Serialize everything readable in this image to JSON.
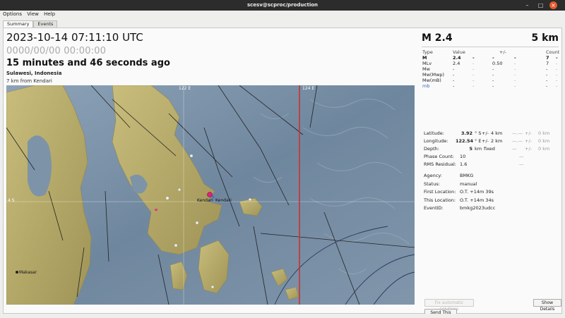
{
  "window": {
    "title": "scesv@scproc/production"
  },
  "menu": [
    "Options",
    "View",
    "Help"
  ],
  "tabs": [
    {
      "label": "Summary",
      "active": true
    },
    {
      "label": "Events",
      "active": false
    }
  ],
  "summary": {
    "origin_time": "2023-10-14 07:11:10 UTC",
    "placeholder_time": "0000/00/00  00:00:00",
    "elapsed": "15 minutes and 46 seconds ago",
    "region": "Sulawesi, Indonesia",
    "distance": "7 km from Kendari"
  },
  "map": {
    "labels": {
      "lon_122": "122 E",
      "lon_124": "124 E",
      "lat_4s": "4 S",
      "city_kendari": "Kendari",
      "city_kendari2": "Kendari",
      "city_makasar": "Makasar"
    },
    "colors": {
      "sea": "#7d93a8",
      "land": "#b9ad6a",
      "event": "#e0207a",
      "meridian_line": "#d12a2a"
    }
  },
  "magnitude": {
    "title": "M 2.4",
    "depth_title": "5 km",
    "headers": {
      "type": "Type",
      "value": "Value",
      "unc": "+/-",
      "count": "Count"
    },
    "rows": [
      {
        "type": "M",
        "value": "2.4",
        "sep": "-",
        "unc": "-",
        "sep2": "-",
        "count": "7",
        "sep3": "-",
        "bold": true
      },
      {
        "type": "MLv",
        "value": "2.4",
        "sep": "-",
        "unc": "0.50",
        "sep2": "-",
        "count": "7",
        "sep3": "-"
      },
      {
        "type": "Mw",
        "value": "-",
        "sep": "-",
        "unc": "-",
        "sep2": "-",
        "count": "-",
        "sep3": "-"
      },
      {
        "type": "Mw(Mwp)",
        "value": "-",
        "sep": "-",
        "unc": "-",
        "sep2": "-",
        "count": "-",
        "sep3": "-"
      },
      {
        "type": "Mw(mB)",
        "value": "-",
        "sep": "-",
        "unc": "-",
        "sep2": "-",
        "count": "-",
        "sep3": "-"
      },
      {
        "type": "mb",
        "value": "-",
        "sep": "-",
        "unc": "-",
        "sep2": "-",
        "count": "-",
        "sep3": "-",
        "blue": true
      }
    ]
  },
  "location": {
    "latitude": {
      "label": "Latitude:",
      "value": "3.92",
      "unit": "° S",
      "pm": "+/-",
      "unc": "4 km",
      "x1": "—.—",
      "x2": "+/-",
      "x3": "0 km"
    },
    "longitude": {
      "label": "Longitude:",
      "value": "122.54",
      "unit": "° E",
      "pm": "+/-",
      "unc": "2 km",
      "x1": "—.—",
      "x2": "+/-",
      "x3": "0 km"
    },
    "depth": {
      "label": "Depth:",
      "value": "5",
      "unit": "km",
      "pm": "fixed",
      "x1": "—",
      "x2": "+/-",
      "x3": "0 km"
    },
    "phase_count": {
      "label": "Phase Count:",
      "value": "10",
      "x1": "—"
    },
    "rms_residual": {
      "label": "RMS Residual:",
      "value": "1.6",
      "x1": "—"
    }
  },
  "info": {
    "agency": {
      "label": "Agency:",
      "value": "BMKG"
    },
    "status": {
      "label": "Status:",
      "value": "manual"
    },
    "first_location": {
      "label": "First Location:",
      "value": "O.T. +14m 39s"
    },
    "this_location": {
      "label": "This Location:",
      "value": "O.T. +14m 34s"
    },
    "event_id": {
      "label": "EventID:",
      "value": "bmkg2023udcc"
    }
  },
  "buttons": {
    "fix_auto": "Fix automatic solutions",
    "show_details": "Show Details",
    "send_data": "Send This Data"
  }
}
